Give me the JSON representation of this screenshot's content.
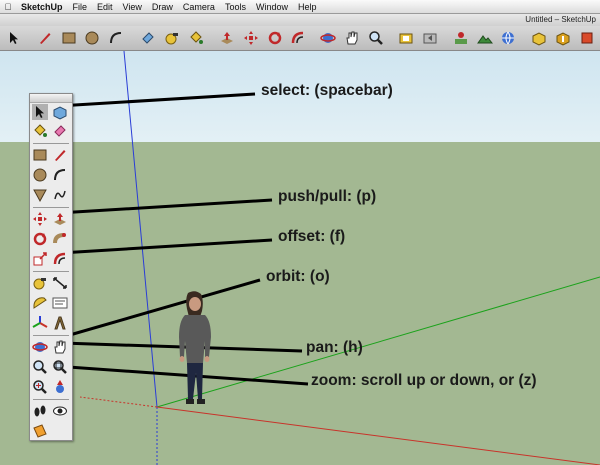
{
  "menubar": {
    "apple_icon": "apple-icon",
    "items": [
      "SketchUp",
      "File",
      "Edit",
      "View",
      "Draw",
      "Camera",
      "Tools",
      "Window",
      "Help"
    ]
  },
  "window": {
    "title": "Untitled – SketchUp"
  },
  "callouts": {
    "select": "select: (spacebar)",
    "push_pull": "push/pull: (p)",
    "offset": "offset: (f)",
    "orbit": "orbit: (o)",
    "pan": "pan: (h)",
    "zoom": "zoom: scroll up or down, or (z)"
  },
  "colors": {
    "sky": "#d8eaf2",
    "ground": "#a3b892",
    "axis_blue": "#2a3dd6",
    "axis_green": "#1ba21b",
    "axis_red": "#c8332a",
    "callout_line": "#000000"
  },
  "toolbar_icons": [
    "select-icon",
    "pencil-line-icon",
    "rectangle-icon",
    "circle-icon",
    "arc-icon",
    "eraser-icon",
    "tape-measure-icon",
    "paint-bucket-icon",
    "push-pull-icon",
    "move-icon",
    "rotate-icon",
    "offset-icon",
    "orbit-icon",
    "pan-icon",
    "zoom-icon",
    "zoom-extents-icon",
    "previous-view-icon",
    "add-location-icon",
    "toggle-terrain-icon",
    "get-models-icon",
    "component-icon",
    "share-model-icon",
    "extension-icon"
  ],
  "palette_icons": [
    "select-icon",
    "make-component-icon",
    "paint-bucket-icon",
    "eraser-icon",
    "rectangle-icon",
    "line-icon",
    "circle-icon",
    "arc-icon",
    "polygon-icon",
    "freehand-icon",
    "move-icon",
    "push-pull-icon",
    "rotate-icon",
    "follow-me-icon",
    "scale-icon",
    "offset-icon",
    "tape-measure-icon",
    "dimension-icon",
    "protractor-icon",
    "text-icon",
    "axes-icon",
    "3d-text-icon",
    "orbit-icon",
    "pan-icon",
    "zoom-icon",
    "zoom-window-icon",
    "zoom-extents-icon",
    "position-camera-icon",
    "walk-icon",
    "look-around-icon",
    "section-plane-icon"
  ]
}
